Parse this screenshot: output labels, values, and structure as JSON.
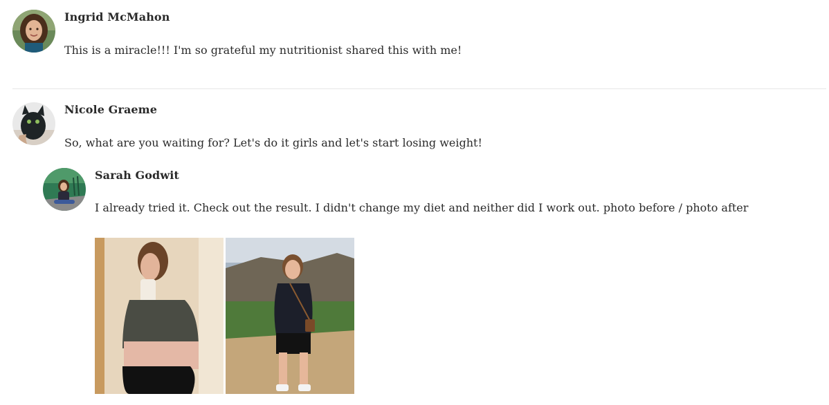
{
  "comments": [
    {
      "author": "Ingrid McMahon",
      "text": "This is a miracle!!! I'm so grateful my nutritionist shared this with me!"
    },
    {
      "author": "Nicole Graeme",
      "text": "So, what are you waiting for? Let's do it girls and let's start losing weight!"
    },
    {
      "author": "Sarah Godwit",
      "text": "I already tried it. Check out the result. I didn't change my diet and neither did I work out. photo before / photo after"
    }
  ],
  "attachment": {
    "icon": "before-after-photo"
  },
  "colors": {
    "text": "#2a2a2a",
    "divider": "#e6e6e6"
  }
}
